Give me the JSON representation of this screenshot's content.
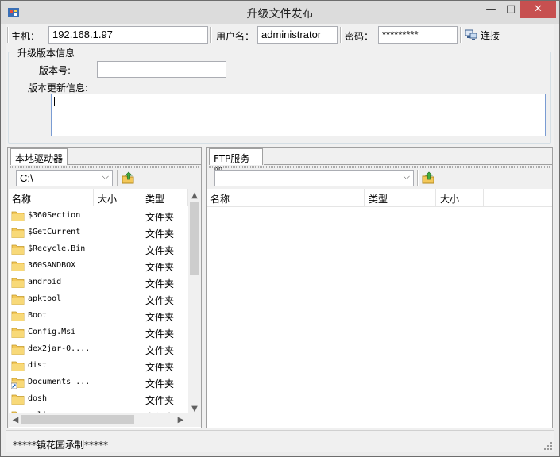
{
  "window": {
    "title": "升级文件发布",
    "min_symbol": "—",
    "max_symbol": "□",
    "close_symbol": "✕"
  },
  "connection": {
    "host_label": "主机：",
    "host_value": "192.168.1.97",
    "user_label": "用户名：",
    "user_value": "administrator",
    "password_label": "密码：",
    "password_value": "*********",
    "connect_label": "连接"
  },
  "upgrade_info": {
    "group_title": "升级版本信息",
    "version_label": "版本号:",
    "version_value": "",
    "notes_label": "版本更新信息:",
    "notes_value": ""
  },
  "local_panel": {
    "tab_label": "本地驱动器",
    "drive_value": "C:\\",
    "columns": [
      "名称",
      "大小",
      "类型"
    ],
    "rows": [
      {
        "name": "$360Section",
        "size": "",
        "type": "文件夹",
        "icon": "folder-icon"
      },
      {
        "name": "$GetCurrent",
        "size": "",
        "type": "文件夹",
        "icon": "folder-icon"
      },
      {
        "name": "$Recycle.Bin",
        "size": "",
        "type": "文件夹",
        "icon": "folder-icon"
      },
      {
        "name": "360SANDBOX",
        "size": "",
        "type": "文件夹",
        "icon": "folder-icon"
      },
      {
        "name": "android",
        "size": "",
        "type": "文件夹",
        "icon": "folder-icon"
      },
      {
        "name": "apktool",
        "size": "",
        "type": "文件夹",
        "icon": "folder-icon"
      },
      {
        "name": "Boot",
        "size": "",
        "type": "文件夹",
        "icon": "folder-icon"
      },
      {
        "name": "Config.Msi",
        "size": "",
        "type": "文件夹",
        "icon": "folder-icon"
      },
      {
        "name": "dex2jar-0....",
        "size": "",
        "type": "文件夹",
        "icon": "folder-icon"
      },
      {
        "name": "dist",
        "size": "",
        "type": "文件夹",
        "icon": "folder-icon"
      },
      {
        "name": "Documents ...",
        "size": "",
        "type": "文件夹",
        "icon": "folder-shortcut-icon"
      },
      {
        "name": "dosh",
        "size": "",
        "type": "文件夹",
        "icon": "folder-icon"
      },
      {
        "name": "eclipse",
        "size": "",
        "type": "文件夹",
        "icon": "folder-icon"
      }
    ]
  },
  "ftp_panel": {
    "tab_label": "FTP服务器",
    "path_value": "",
    "columns": [
      "名称",
      "类型",
      "大小"
    ]
  },
  "status": {
    "text": "*****镜花园承制*****"
  },
  "colors": {
    "folder": "#f3c85a",
    "accent_border": "#7a9cd3",
    "close_button": "#c75050"
  }
}
